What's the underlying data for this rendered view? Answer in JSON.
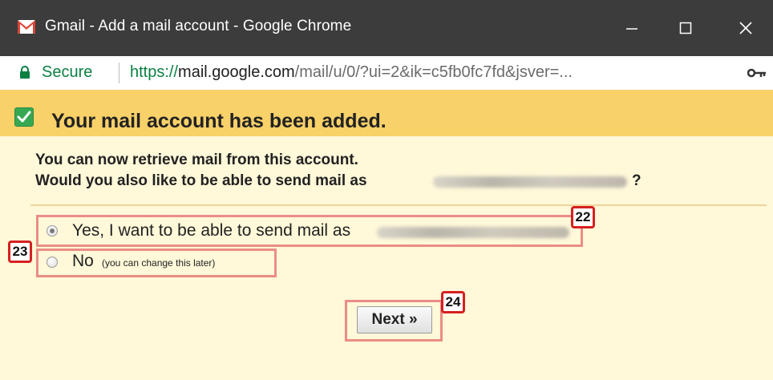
{
  "window": {
    "title": "Gmail - Add a mail account - Google Chrome",
    "icon": "gmail-icon"
  },
  "addressbar": {
    "secure_label": "Secure",
    "url_protocol": "https://",
    "url_host": "mail.google.com",
    "url_path": "/mail/u/0/?ui=2&ik=c5fb0fc7fd&jsver=..."
  },
  "banner": {
    "text": "Your mail account has been added."
  },
  "message": {
    "line1": "You can now retrieve mail from this account.",
    "line2": "Would you also like to be able to send mail as",
    "line2_end": "?"
  },
  "options": {
    "yes_label": "Yes, I want to be able to send mail as",
    "no_label": "No",
    "no_hint": "(you can change this later)",
    "selected": "yes"
  },
  "next_label": "Next »",
  "annotations": {
    "badge_yes": "22",
    "badge_no": "23",
    "badge_next": "24"
  },
  "colors": {
    "banner": "#f9d169",
    "page_bg": "#fff8d9",
    "highlight": "#eb8d86",
    "badge_border": "#d62020",
    "secure_green": "#0b8043"
  }
}
